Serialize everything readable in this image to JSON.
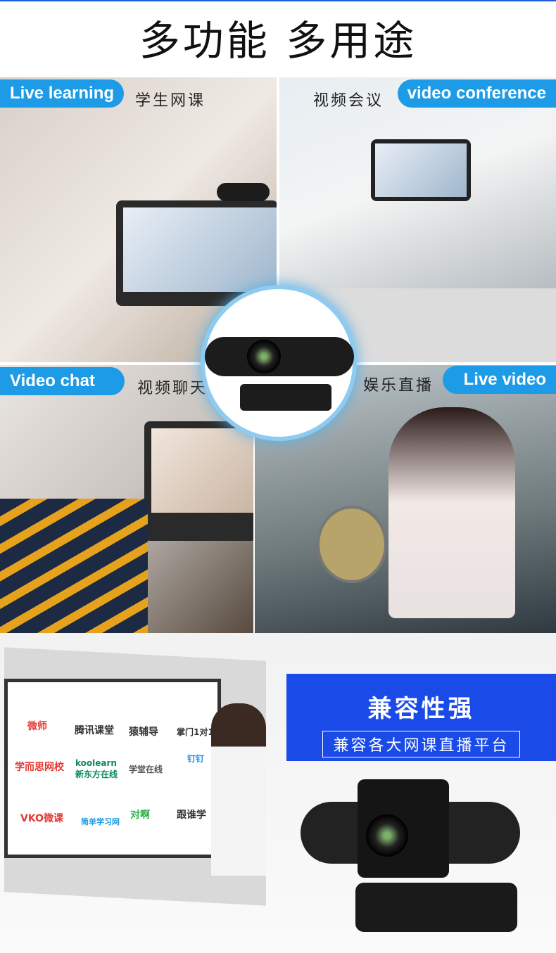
{
  "title": "多功能 多用途",
  "scenes": [
    {
      "en": "Live learning",
      "cn": "学生网课"
    },
    {
      "en": "video conference",
      "cn": "视频会议"
    },
    {
      "en": "Video chat",
      "cn": "视频聊天"
    },
    {
      "en": "Live video",
      "cn": "娱乐直播"
    }
  ],
  "compat": {
    "heading": "兼容性强",
    "subtitle": "兼容各大网课直播平台"
  },
  "platforms": [
    "微师",
    "腾讯课堂",
    "猿辅导",
    "掌门1对1",
    "学而思网校",
    "koolearn 新东方在线",
    "学堂在线",
    "钉钉",
    "VKO微课",
    "简单学习网",
    "对啊",
    "跟谁学"
  ],
  "colors": {
    "accent": "#1d9be6",
    "box": "#1a4be8"
  }
}
